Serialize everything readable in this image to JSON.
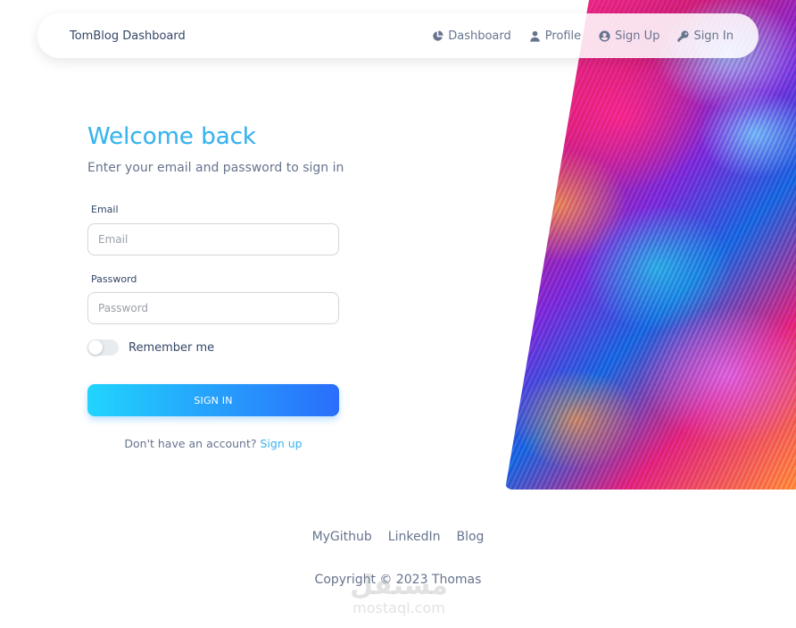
{
  "navbar": {
    "brand": "TomBlog Dashboard",
    "links": [
      {
        "label": "Dashboard",
        "icon": "pie-chart-icon"
      },
      {
        "label": "Profile",
        "icon": "user-icon"
      },
      {
        "label": "Sign Up",
        "icon": "user-circle-icon"
      },
      {
        "label": "Sign In",
        "icon": "key-icon"
      }
    ]
  },
  "form": {
    "title": "Welcome back",
    "subtitle": "Enter your email and password to sign in",
    "email_label": "Email",
    "email_placeholder": "Email",
    "password_label": "Password",
    "password_placeholder": "Password",
    "remember_label": "Remember me",
    "remember_checked": false,
    "submit_label": "SIGN IN",
    "signup_prompt": "Don't have an account?",
    "signup_link": "Sign up"
  },
  "footer": {
    "links": [
      "MyGithub",
      "LinkedIn",
      "Blog"
    ],
    "copyright": "Copyright © 2023 Thomas"
  },
  "watermark": {
    "arabic": "مستقل",
    "latin": "mostaql.com"
  },
  "colors": {
    "accent_start": "#21d4fd",
    "accent_end": "#2a6dfb",
    "text_dark": "#344767",
    "text_muted": "#67748e",
    "link": "#3ab4ec"
  }
}
